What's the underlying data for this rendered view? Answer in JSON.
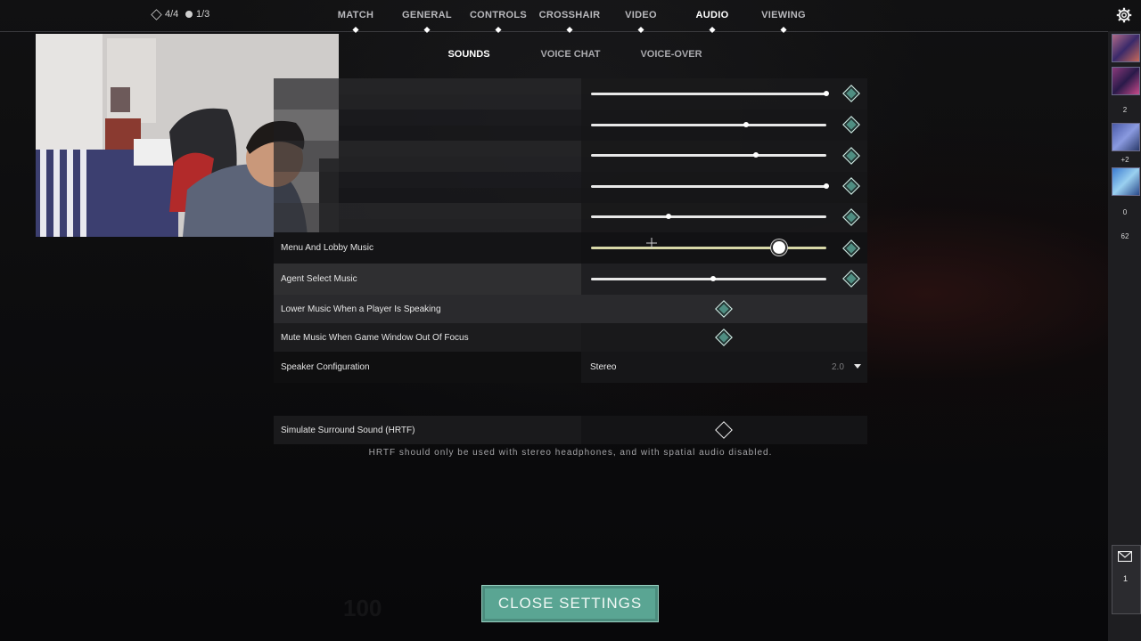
{
  "status": {
    "left_counter": "4/4",
    "right_counter": "1/3"
  },
  "top_nav": [
    {
      "label": "MATCH",
      "active": false
    },
    {
      "label": "GENERAL",
      "active": false
    },
    {
      "label": "CONTROLS",
      "active": false
    },
    {
      "label": "CROSSHAIR",
      "active": false
    },
    {
      "label": "VIDEO",
      "active": false
    },
    {
      "label": "AUDIO",
      "active": true
    },
    {
      "label": "VIEWING",
      "active": false
    }
  ],
  "sub_nav": [
    {
      "label": "SOUNDS",
      "active": true
    },
    {
      "label": "VOICE CHAT",
      "active": false
    },
    {
      "label": "VOICE-OVER",
      "active": false
    }
  ],
  "settings": {
    "sliders": [
      {
        "label": "",
        "value": 1.0
      },
      {
        "label": "",
        "value": 0.66
      },
      {
        "label": "",
        "value": 0.7
      },
      {
        "label": "",
        "value": 1.0
      },
      {
        "label": "",
        "value": 0.33
      },
      {
        "label": "Menu And Lobby Music",
        "value": 0.8
      },
      {
        "label": "Agent Select Music",
        "value": 0.52
      }
    ],
    "toggles": [
      {
        "label": "Lower Music When a Player Is Speaking",
        "checked": true
      },
      {
        "label": "Mute Music When Game Window Out Of Focus",
        "checked": true
      }
    ],
    "speaker_config": {
      "label": "Speaker Configuration",
      "value": "Stereo",
      "channels": "2.0"
    },
    "hrtf": {
      "label": "Simulate Surround Sound (HRTF)",
      "checked": false,
      "note": "HRTF should only be used with stereo headphones, and with spatial audio disabled."
    }
  },
  "close_button": "CLOSE SETTINGS",
  "party": {
    "count_1": "2",
    "count_2": "+2",
    "count_3": "0",
    "count_4": "62",
    "mail_count": "1"
  },
  "colors": {
    "accent": "#5aa593",
    "diamond_fill": "#4f8e82",
    "highlight_row": "#2f2f31"
  },
  "icons": [
    "settings-gear-icon",
    "mail-icon",
    "diamond-checkbox-icon",
    "dropdown-caret-icon"
  ]
}
